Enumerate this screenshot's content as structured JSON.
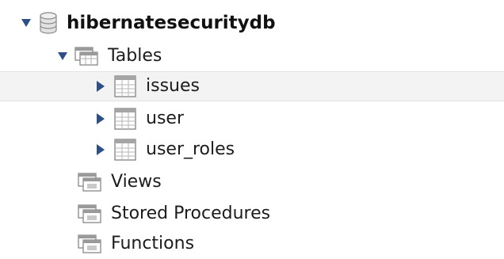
{
  "tree": {
    "database": {
      "name": "hibernatesecuritydb",
      "expanded": true,
      "icon": "database-icon"
    },
    "tables_folder": {
      "label": "Tables",
      "expanded": true,
      "icon": "folder-tables-icon"
    },
    "tables": [
      {
        "name": "issues",
        "icon": "table-icon",
        "selected": true
      },
      {
        "name": "user",
        "icon": "table-icon",
        "selected": false
      },
      {
        "name": "user_roles",
        "icon": "table-icon",
        "selected": false
      }
    ],
    "views_folder": {
      "label": "Views",
      "icon": "folder-views-icon"
    },
    "procedures_folder": {
      "label": "Stored Procedures",
      "icon": "folder-procedures-icon"
    },
    "functions_folder": {
      "label": "Functions",
      "icon": "folder-functions-icon"
    }
  },
  "colors": {
    "expander": "#2b4f86",
    "selection": "#f3f3f3",
    "icon_gray": "#8a8a8a"
  }
}
